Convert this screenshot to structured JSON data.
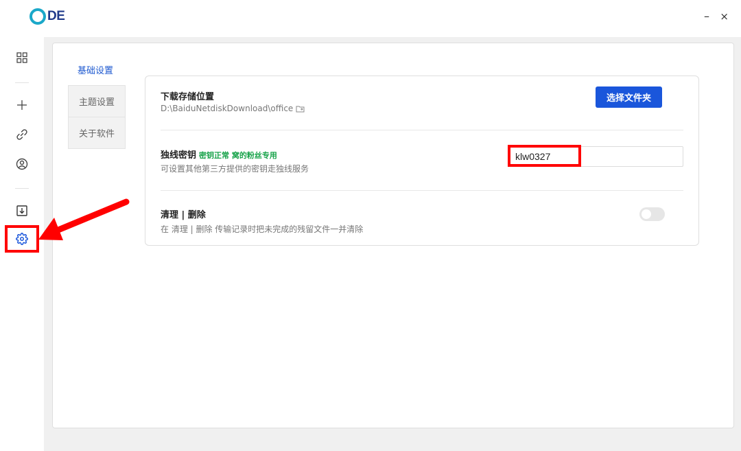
{
  "app": {
    "logo_text": "DE",
    "minimize": "–",
    "close": "×"
  },
  "sidebar": {
    "items": [
      {
        "icon": "apps-grid-icon"
      },
      {
        "icon": "plus-icon"
      },
      {
        "icon": "link-icon"
      },
      {
        "icon": "user-circle-icon"
      },
      {
        "icon": "download-box-icon"
      },
      {
        "icon": "gear-icon"
      }
    ]
  },
  "settings": {
    "active_tab": "基础设置",
    "tabs": [
      "主题设置",
      "关于软件"
    ],
    "download": {
      "title": "下载存储位置",
      "path": "D:\\BaiduNetdiskDownload\\office",
      "button": "选择文件夹"
    },
    "key": {
      "title": "独线密钥",
      "status": "密钥正常 窝的粉丝专用",
      "desc": "可设置其他第三方提供的密钥走独线服务",
      "value": "klw0327"
    },
    "cleanup": {
      "title": "清理 | 删除",
      "desc": "在 清理 | 删除 传输记录时把未完成的残留文件一并清除",
      "enabled": false
    }
  },
  "colors": {
    "accent": "#1a56db",
    "status_green": "#18a34a",
    "annotation_red": "#ff0000"
  }
}
